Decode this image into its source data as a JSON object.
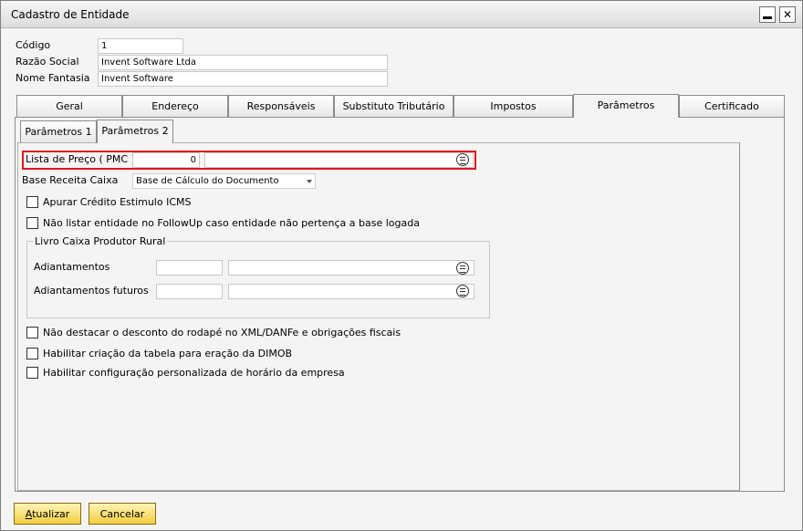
{
  "window": {
    "title": "Cadastro de Entidade",
    "minimize_glyph": "—",
    "close_glyph": "✕"
  },
  "header": {
    "codigo_label": "Código",
    "codigo_value": "1",
    "razao_label": "Razão Social",
    "razao_value": "Invent Software Ltda",
    "fantasia_label": "Nome Fantasia",
    "fantasia_value": "Invent Software"
  },
  "tabs": [
    {
      "label": "Geral"
    },
    {
      "label": "Endereço"
    },
    {
      "label": "Responsáveis"
    },
    {
      "label": "Substituto Tributário"
    },
    {
      "label": "Impostos"
    },
    {
      "label": "Parâmetros"
    },
    {
      "label": "Certificado"
    }
  ],
  "active_tab": "Parâmetros",
  "subtabs": [
    {
      "label": "Parâmetros 1"
    },
    {
      "label": "Parâmetros 2"
    }
  ],
  "active_subtab": "Parâmetros 2",
  "params": {
    "lista_preco_label": "Lista de Preço ( PMC )",
    "lista_preco_code": "0",
    "lista_preco_desc": "",
    "base_receita_label": "Base Receita Caixa",
    "base_receita_value": "Base de Cálculo do Documento",
    "apurar_label": "Apurar Crédito Estimulo ICMS",
    "nao_listar_label": "Não listar entidade no FollowUp caso entidade não pertença a base logada",
    "livro_caixa_title": "Livro Caixa Produtor Rural",
    "adiantamentos_label": "Adiantamentos",
    "adiantamentos_futuros_label": "Adiantamentos futuros",
    "nao_destacar_label": "Não destacar o desconto do rodapé no XML/DANFe e obrigações fiscais",
    "habilitar_dimob_label": "Habilitar criação da tabela para eração da DIMOB",
    "habilitar_horario_label": "Habilitar configuração personalizada de horário da empresa"
  },
  "footer": {
    "atualizar_first": "A",
    "atualizar_rest": "tualizar",
    "cancelar_label": "Cancelar"
  },
  "colors": {
    "highlight_border": "#e0161e",
    "button_fill": "#f3cd3f"
  }
}
